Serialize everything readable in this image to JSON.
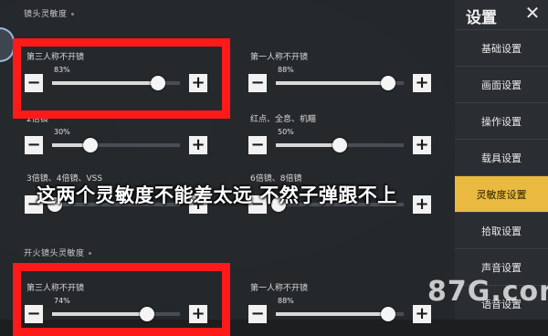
{
  "section_scope": {
    "title": "镜头灵敏度"
  },
  "section_fire": {
    "title": "开火镜头灵敏度"
  },
  "sliders_scope": [
    {
      "label": "第三人称不开镜",
      "value": "83%",
      "level": 83
    },
    {
      "label": "第一人称不开镜",
      "value": "88%",
      "level": 88
    },
    {
      "label": "2倍镜",
      "value": "30%",
      "level": 30
    },
    {
      "label": "红点、全息、机瞄",
      "value": "50%",
      "level": 50
    },
    {
      "label": "3倍镜、4倍镜、VSS",
      "value": "",
      "level": 2
    },
    {
      "label": "6倍镜、8倍镜",
      "value": "",
      "level": 2
    }
  ],
  "sliders_fire": [
    {
      "label": "第三人称不开镜",
      "value": "74%",
      "level": 74
    },
    {
      "label": "第一人称不开镜",
      "value": "88%",
      "level": 88
    }
  ],
  "caption": "这两个灵敏度不能差太远 不然子弹跟不上",
  "sidebar": {
    "title": "设置",
    "close_icon": "close-icon",
    "items": [
      {
        "label": "基础设置",
        "active": false
      },
      {
        "label": "画面设置",
        "active": false
      },
      {
        "label": "操作设置",
        "active": false
      },
      {
        "label": "载具设置",
        "active": false
      },
      {
        "label": "灵敏度设置",
        "active": true
      },
      {
        "label": "拾取设置",
        "active": false
      },
      {
        "label": "声音设置",
        "active": false
      },
      {
        "label": "语音设置",
        "active": false
      }
    ]
  },
  "watermark": {
    "text": "87G.com"
  },
  "colors": {
    "highlight": "#ff1a1a",
    "active_tab": "#e9ba3f",
    "panel": "#26292d"
  }
}
